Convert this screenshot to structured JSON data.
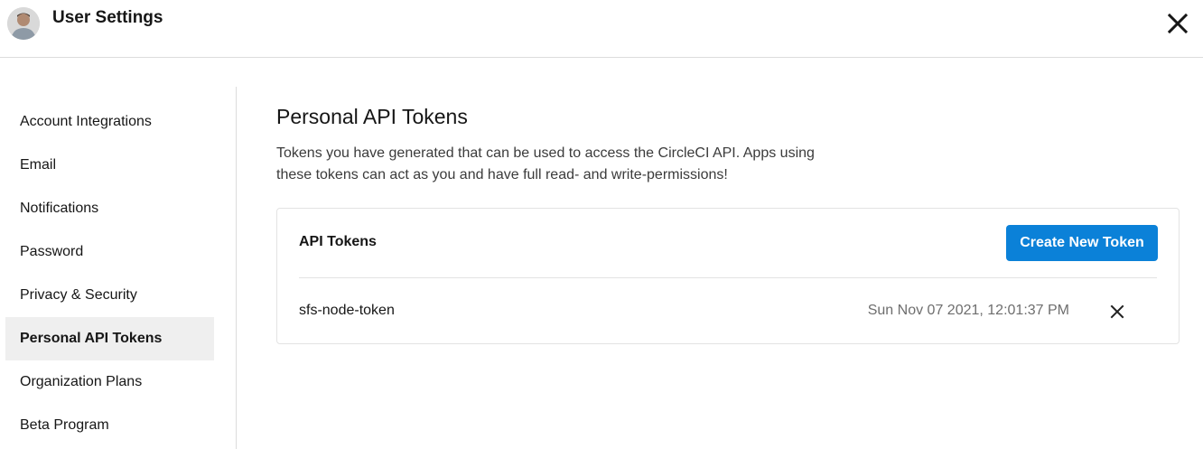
{
  "header": {
    "title": "User Settings",
    "avatar_icon": "user-avatar",
    "close_icon": "close-icon"
  },
  "sidebar": {
    "items": [
      {
        "label": "Account Integrations",
        "active": false
      },
      {
        "label": "Email",
        "active": false
      },
      {
        "label": "Notifications",
        "active": false
      },
      {
        "label": "Password",
        "active": false
      },
      {
        "label": "Privacy & Security",
        "active": false
      },
      {
        "label": "Personal API Tokens",
        "active": true
      },
      {
        "label": "Organization Plans",
        "active": false
      },
      {
        "label": "Beta Program",
        "active": false
      }
    ]
  },
  "main": {
    "title": "Personal API Tokens",
    "description_line1": "Tokens you have generated that can be used to access the CircleCI API. Apps using",
    "description_line2": "these tokens can act as you and have full read- and write-permissions!",
    "card": {
      "title": "API Tokens",
      "create_button": "Create New Token",
      "tokens": [
        {
          "name": "sfs-node-token",
          "created": "Sun Nov 07 2021, 12:01:37 PM",
          "delete_icon": "close-icon"
        }
      ]
    }
  },
  "colors": {
    "primary_button": "#0b81d8",
    "active_item_bg": "#efefef",
    "divider": "#dcdcdc"
  }
}
